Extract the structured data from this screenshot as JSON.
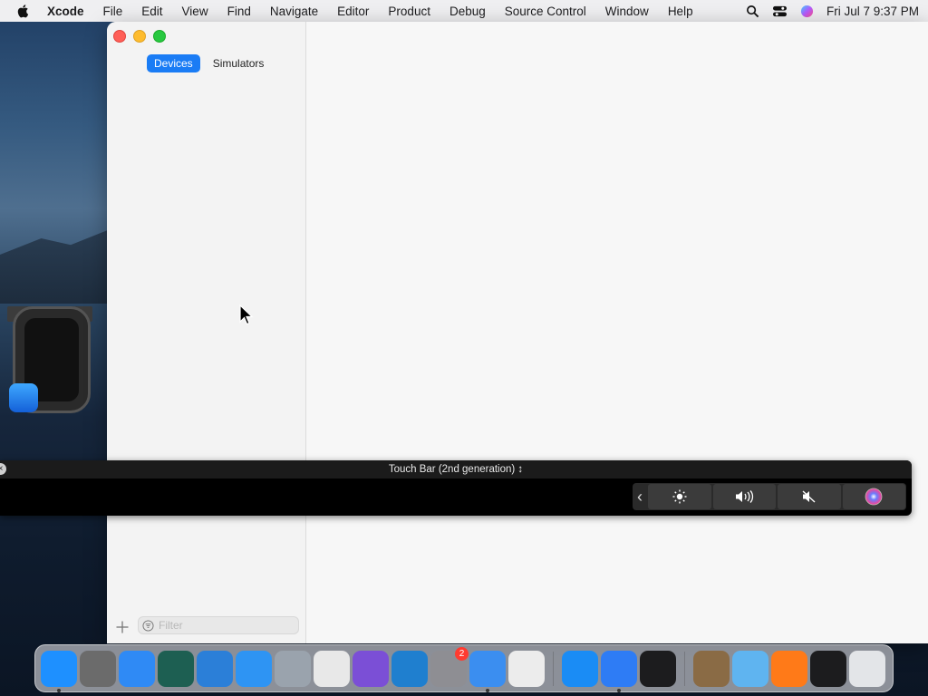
{
  "menubar": {
    "apple_icon": "apple-icon",
    "items": [
      "Xcode",
      "File",
      "Edit",
      "View",
      "Find",
      "Navigate",
      "Editor",
      "Product",
      "Debug",
      "Source Control",
      "Window",
      "Help"
    ],
    "clock": "Fri Jul 7  9:37 PM",
    "status_icons": [
      "search-icon",
      "control-center-icon",
      "siri-icon"
    ]
  },
  "window": {
    "tabs": [
      {
        "label": "Devices",
        "active": true
      },
      {
        "label": "Simulators",
        "active": false
      }
    ],
    "filter_placeholder": "Filter",
    "add_icon": "plus-icon"
  },
  "touchbar": {
    "title": "Touch Bar (2nd generation) ↕",
    "controls": [
      "chevron-left-icon",
      "brightness-icon",
      "volume-icon",
      "mute-icon",
      "siri-icon"
    ]
  },
  "dock": {
    "apps": [
      {
        "name": "finder",
        "color": "#1e90ff",
        "running": true
      },
      {
        "name": "script-editor",
        "color": "#6b6b6b",
        "running": false
      },
      {
        "name": "safari",
        "color": "#2f8af5",
        "running": false
      },
      {
        "name": "time-machine",
        "color": "#1d5f52",
        "running": false
      },
      {
        "name": "acrobat-like",
        "color": "#2b7fd8",
        "running": false
      },
      {
        "name": "app-store-connect",
        "color": "#2e94f3",
        "running": false
      },
      {
        "name": "instruments",
        "color": "#9aa3ad",
        "running": false
      },
      {
        "name": "chrome",
        "color": "#e8e8e8",
        "running": false
      },
      {
        "name": "visual-studio",
        "color": "#7b4fd6",
        "running": false
      },
      {
        "name": "vscode",
        "color": "#1f7fcf",
        "running": false
      },
      {
        "name": "system-settings",
        "color": "#8e8e93",
        "running": false,
        "badge": "2"
      },
      {
        "name": "xcode-tool",
        "color": "#3b8ef0",
        "running": true
      },
      {
        "name": "launchpad",
        "color": "#ececec",
        "running": false
      },
      {
        "name": "app-store",
        "color": "#1a8cf5",
        "running": false
      },
      {
        "name": "xcode",
        "color": "#2e7cf5",
        "running": true
      },
      {
        "name": "activity-monitor",
        "color": "#1c1c1e",
        "running": false
      },
      {
        "name": "archive-utility",
        "color": "#8a6b45",
        "running": false
      },
      {
        "name": "folder",
        "color": "#5fb4f0",
        "running": false
      },
      {
        "name": "firefox",
        "color": "#ff7a18",
        "running": false
      },
      {
        "name": "activity-monitor-2",
        "color": "#1c1c1e",
        "running": false
      },
      {
        "name": "trash",
        "color": "#e3e5e8",
        "running": false
      }
    ]
  }
}
